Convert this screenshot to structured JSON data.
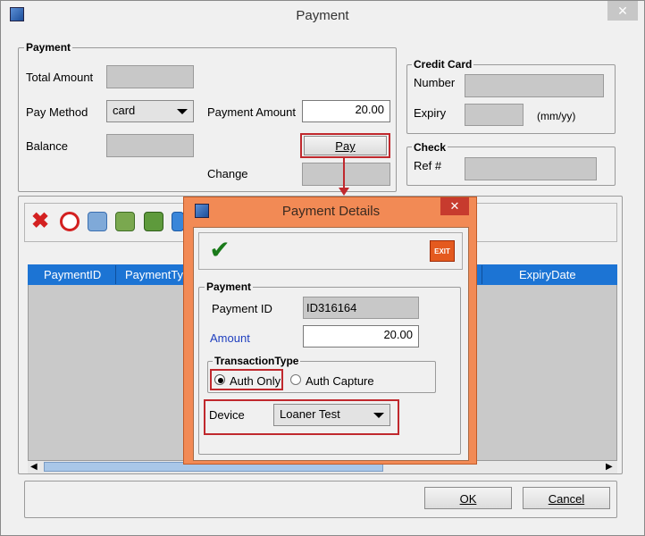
{
  "window": {
    "title": "Payment",
    "close_label": "✕"
  },
  "payment_group": {
    "legend": "Payment",
    "total_amount_label": "Total Amount",
    "total_amount_value": "",
    "pay_method_label": "Pay Method",
    "pay_method_value": "card",
    "payment_amount_label": "Payment Amount",
    "payment_amount_value": "20.00",
    "balance_label": "Balance",
    "balance_value": "",
    "pay_button": "Pay",
    "change_label": "Change",
    "change_value": ""
  },
  "credit_card": {
    "legend": "Credit Card",
    "number_label": "Number",
    "expiry_label": "Expiry",
    "expiry_hint": "(mm/yy)"
  },
  "check": {
    "legend": "Check",
    "ref_label": "Ref #"
  },
  "table": {
    "headers": [
      "PaymentID",
      "PaymentTy",
      "ExpiryDate"
    ]
  },
  "footer": {
    "ok_label": "OK",
    "cancel_label": "Cancel"
  },
  "dialog": {
    "title": "Payment Details",
    "close_label": "✕",
    "exit_label": "EXIT",
    "group_legend": "Payment",
    "payment_id_label": "Payment ID",
    "payment_id_value": "ID316164",
    "amount_label": "Amount",
    "amount_value": "20.00",
    "transaction_legend": "TransactionType",
    "auth_only_label": "Auth Only",
    "auth_capture_label": "Auth Capture",
    "device_label": "Device",
    "device_value": "Loaner Test"
  },
  "colors": {
    "accent": "#1c74d4",
    "highlight": "#c0282d",
    "dialog_frame": "#f28a55"
  }
}
